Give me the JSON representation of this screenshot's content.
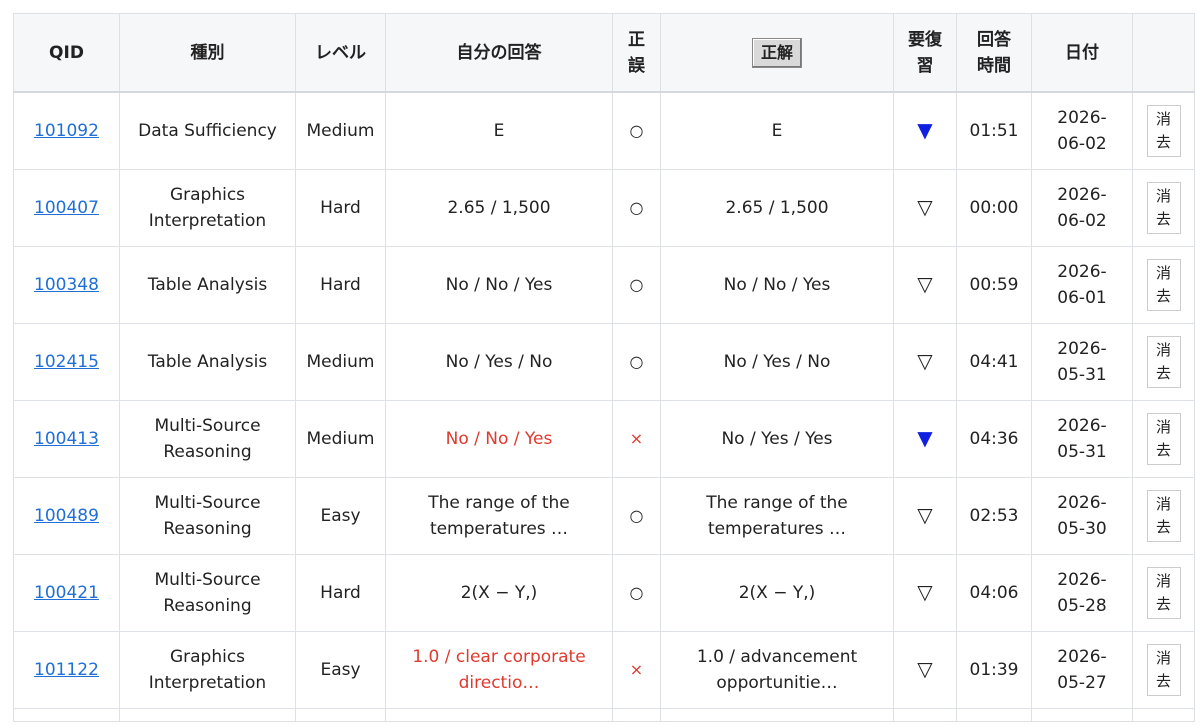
{
  "headers": {
    "qid": "QID",
    "type": "種別",
    "level": "レベル",
    "my_answer": "自分の回答",
    "correct_1": "正",
    "correct_2": "誤",
    "answer_button": "正解",
    "review_1": "要復",
    "review_2": "習",
    "time_1": "回答",
    "time_2": "時間",
    "date": "日付"
  },
  "delete_label_1": "消",
  "delete_label_2": "去",
  "rows": [
    {
      "qid": "101092",
      "type_1": "Data Sufficiency",
      "type_2": "",
      "level": "Medium",
      "my_1": "E",
      "my_2": "",
      "result": "○",
      "ans_1": "E",
      "ans_2": "",
      "review": "▼",
      "time": "01:51",
      "date_1": "2026-",
      "date_2": "06-02"
    },
    {
      "qid": "100407",
      "type_1": "Graphics",
      "type_2": "Interpretation",
      "level": "Hard",
      "my_1": "2.65 / 1,500",
      "my_2": "",
      "result": "○",
      "ans_1": "2.65 / 1,500",
      "ans_2": "",
      "review": "▽",
      "time": "00:00",
      "date_1": "2026-",
      "date_2": "06-02"
    },
    {
      "qid": "100348",
      "type_1": "Table Analysis",
      "type_2": "",
      "level": "Hard",
      "my_1": "No / No / Yes",
      "my_2": "",
      "result": "○",
      "ans_1": "No / No / Yes",
      "ans_2": "",
      "review": "▽",
      "time": "00:59",
      "date_1": "2026-",
      "date_2": "06-01"
    },
    {
      "qid": "102415",
      "type_1": "Table Analysis",
      "type_2": "",
      "level": "Medium",
      "my_1": "No / Yes / No",
      "my_2": "",
      "result": "○",
      "ans_1": "No / Yes / No",
      "ans_2": "",
      "review": "▽",
      "time": "04:41",
      "date_1": "2026-",
      "date_2": "05-31"
    },
    {
      "qid": "100413",
      "type_1": "Multi-Source",
      "type_2": "Reasoning",
      "level": "Medium",
      "my_1": "No / No / Yes",
      "my_2": "",
      "result": "×",
      "ans_1": "No / Yes / Yes",
      "ans_2": "",
      "review": "▼",
      "time": "04:36",
      "date_1": "2026-",
      "date_2": "05-31"
    },
    {
      "qid": "100489",
      "type_1": "Multi-Source",
      "type_2": "Reasoning",
      "level": "Easy",
      "my_1": "The range of the",
      "my_2": "temperatures …",
      "result": "○",
      "ans_1": "The range of the",
      "ans_2": "temperatures …",
      "review": "▽",
      "time": "02:53",
      "date_1": "2026-",
      "date_2": "05-30"
    },
    {
      "qid": "100421",
      "type_1": "Multi-Source",
      "type_2": "Reasoning",
      "level": "Hard",
      "my_1": "2(X − Y,)",
      "my_2": "",
      "result": "○",
      "ans_1": "2(X − Y,)",
      "ans_2": "",
      "review": "▽",
      "time": "04:06",
      "date_1": "2026-",
      "date_2": "05-28"
    },
    {
      "qid": "101122",
      "type_1": "Graphics",
      "type_2": "Interpretation",
      "level": "Easy",
      "my_1": "1.0 / clear corporate",
      "my_2": "directio…",
      "result": "×",
      "ans_1": "1.0 / advancement",
      "ans_2": "opportunitie…",
      "review": "▽",
      "time": "01:39",
      "date_1": "2026-",
      "date_2": "05-27"
    }
  ]
}
